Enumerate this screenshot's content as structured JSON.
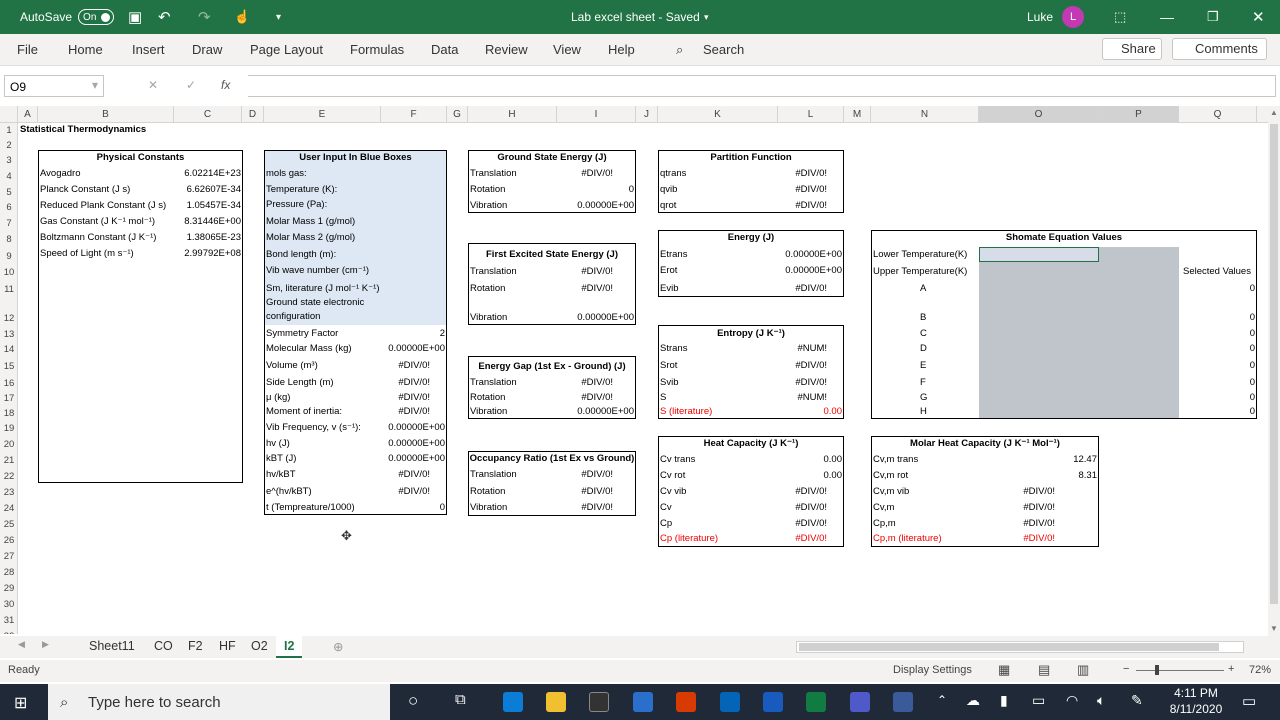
{
  "titlebar": {
    "autosave": "AutoSave",
    "autosave_state": "On",
    "title": "Lab excel sheet - Saved",
    "user": "Luke",
    "avatar_initial": "L"
  },
  "ribbon": {
    "tabs": [
      "File",
      "Home",
      "Insert",
      "Draw",
      "Page Layout",
      "Formulas",
      "Data",
      "Review",
      "View",
      "Help"
    ],
    "search": "Search",
    "share": "Share",
    "comments": "Comments"
  },
  "formula_bar": {
    "name_box": "O9",
    "formula": ""
  },
  "columns": [
    "A",
    "B",
    "C",
    "D",
    "E",
    "F",
    "G",
    "H",
    "I",
    "J",
    "K",
    "L",
    "M",
    "N",
    "O",
    "P",
    "Q"
  ],
  "rows": [
    "1",
    "2",
    "3",
    "4",
    "5",
    "6",
    "7",
    "8",
    "9",
    "10",
    "11",
    "12",
    "13",
    "14",
    "15",
    "16",
    "17",
    "18",
    "19",
    "20",
    "21",
    "22",
    "23",
    "24",
    "25",
    "26",
    "27",
    "28",
    "29",
    "30",
    "31",
    "32"
  ],
  "a1": "Statistical Thermodynamics",
  "physical": {
    "title": "Physical Constants",
    "rows": [
      [
        "Avogadro",
        "6.02214E+23"
      ],
      [
        "Planck Constant (J s)",
        "6.62607E-34"
      ],
      [
        "Reduced Plank Constant (J s)",
        "1.05457E-34"
      ],
      [
        "Gas Constant (J K⁻¹ mol⁻¹)",
        "8.31446E+00"
      ],
      [
        "Boltzmann Constant (J K⁻¹)",
        "1.38065E-23"
      ],
      [
        "Speed of Light (m s⁻¹)",
        "2.99792E+08"
      ]
    ]
  },
  "user": {
    "title": "User Input In Blue Boxes",
    "inputs": [
      "mols gas:",
      "Temperature (K):",
      "Pressure (Pa):",
      "Molar Mass 1 (g/mol)",
      "Molar Mass 2 (g/mol)",
      "Bond length (m):",
      "Vib wave number (cm⁻¹)",
      "Sm, literature (J mol⁻¹ K⁻¹)",
      "Ground state electronic",
      "configuration"
    ],
    "calc": [
      [
        "Symmetry Factor",
        "2"
      ],
      [
        "Molecular Mass (kg)",
        "0.00000E+00"
      ],
      [
        "Volume (m³)",
        "#DIV/0!"
      ],
      [
        "Side Length (m)",
        "#DIV/0!"
      ],
      [
        "μ (kg)",
        "#DIV/0!"
      ],
      [
        "Moment of inertia:",
        "#DIV/0!"
      ],
      [
        "Vib Frequency, v (s⁻¹):",
        "0.00000E+00"
      ],
      [
        "hv (J)",
        "0.00000E+00"
      ],
      [
        "kBT (J)",
        "0.00000E+00"
      ],
      [
        "hv/kBT",
        "#DIV/0!"
      ],
      [
        "e^(hv/kBT)",
        "#DIV/0!"
      ],
      [
        "t (Tempreature/1000)",
        "0"
      ]
    ]
  },
  "ground": {
    "title": "Ground State Energy (J)",
    "rows": [
      [
        "Translation",
        "#DIV/0!"
      ],
      [
        "Rotation",
        "0"
      ],
      [
        "Vibration",
        "0.00000E+00"
      ]
    ]
  },
  "first": {
    "title": "First Excited State Energy (J)",
    "rows": [
      [
        "Translation",
        "#DIV/0!"
      ],
      [
        "Rotation",
        "#DIV/0!"
      ],
      [
        "Vibration",
        "0.00000E+00"
      ]
    ]
  },
  "gap": {
    "title": "Energy Gap (1st Ex - Ground) (J)",
    "rows": [
      [
        "Translation",
        "#DIV/0!"
      ],
      [
        "Rotation",
        "#DIV/0!"
      ],
      [
        "Vibration",
        "0.00000E+00"
      ]
    ]
  },
  "occ": {
    "title": "Occupancy Ratio (1st Ex vs Ground)",
    "rows": [
      [
        "Translation",
        "#DIV/0!"
      ],
      [
        "Rotation",
        "#DIV/0!"
      ],
      [
        "Vibration",
        "#DIV/0!"
      ]
    ]
  },
  "partition": {
    "title": "Partition Function",
    "rows": [
      [
        "qtrans",
        "#DIV/0!"
      ],
      [
        "qvib",
        "#DIV/0!"
      ],
      [
        "qrot",
        "#DIV/0!"
      ]
    ]
  },
  "energy": {
    "title": "Energy (J)",
    "rows": [
      [
        "Etrans",
        "0.00000E+00"
      ],
      [
        "Erot",
        "0.00000E+00"
      ],
      [
        "Evib",
        "#DIV/0!"
      ]
    ]
  },
  "entropy": {
    "title": "Entropy (J K⁻¹)",
    "rows": [
      [
        "Strans",
        "#NUM!"
      ],
      [
        "Srot",
        "#DIV/0!"
      ],
      [
        "Svib",
        "#DIV/0!"
      ],
      [
        "S",
        "#NUM!"
      ],
      [
        "S (literature)",
        "0.00"
      ]
    ]
  },
  "heat": {
    "title": "Heat Capacity (J K⁻¹)",
    "rows": [
      [
        "Cv trans",
        "0.00"
      ],
      [
        "Cv rot",
        "0.00"
      ],
      [
        "Cv vib",
        "#DIV/0!"
      ],
      [
        "Cv",
        "#DIV/0!"
      ],
      [
        "Cp",
        "#DIV/0!"
      ],
      [
        "Cp (literature)",
        "#DIV/0!"
      ]
    ]
  },
  "shomate": {
    "title": "Shomate Equation Values",
    "lower": "Lower Temperature(K)",
    "upper": "Upper Temperature(K)",
    "selected": "Selected Values",
    "letters": [
      "A",
      "B",
      "C",
      "D",
      "E",
      "F",
      "G",
      "H"
    ],
    "values": [
      "0",
      "0",
      "0",
      "0",
      "0",
      "0",
      "0",
      "0"
    ]
  },
  "molar": {
    "title": "Molar Heat Capacity (J K⁻¹ Mol⁻¹)",
    "rows": [
      [
        "Cv,m trans",
        "12.47"
      ],
      [
        "Cv,m rot",
        "8.31"
      ],
      [
        "Cv,m vib",
        "#DIV/0!"
      ],
      [
        "Cv,m",
        "#DIV/0!"
      ],
      [
        "Cp,m",
        "#DIV/0!"
      ],
      [
        "Cp,m (literature)",
        "#DIV/0!"
      ]
    ]
  },
  "sheets": [
    "Sheet11",
    "CO",
    "F2",
    "HF",
    "O2",
    "I2"
  ],
  "status": {
    "ready": "Ready",
    "display": "Display Settings",
    "zoom": "72%"
  },
  "taskbar": {
    "search": "Type here to search",
    "time": "4:11 PM",
    "date": "8/11/2020"
  }
}
